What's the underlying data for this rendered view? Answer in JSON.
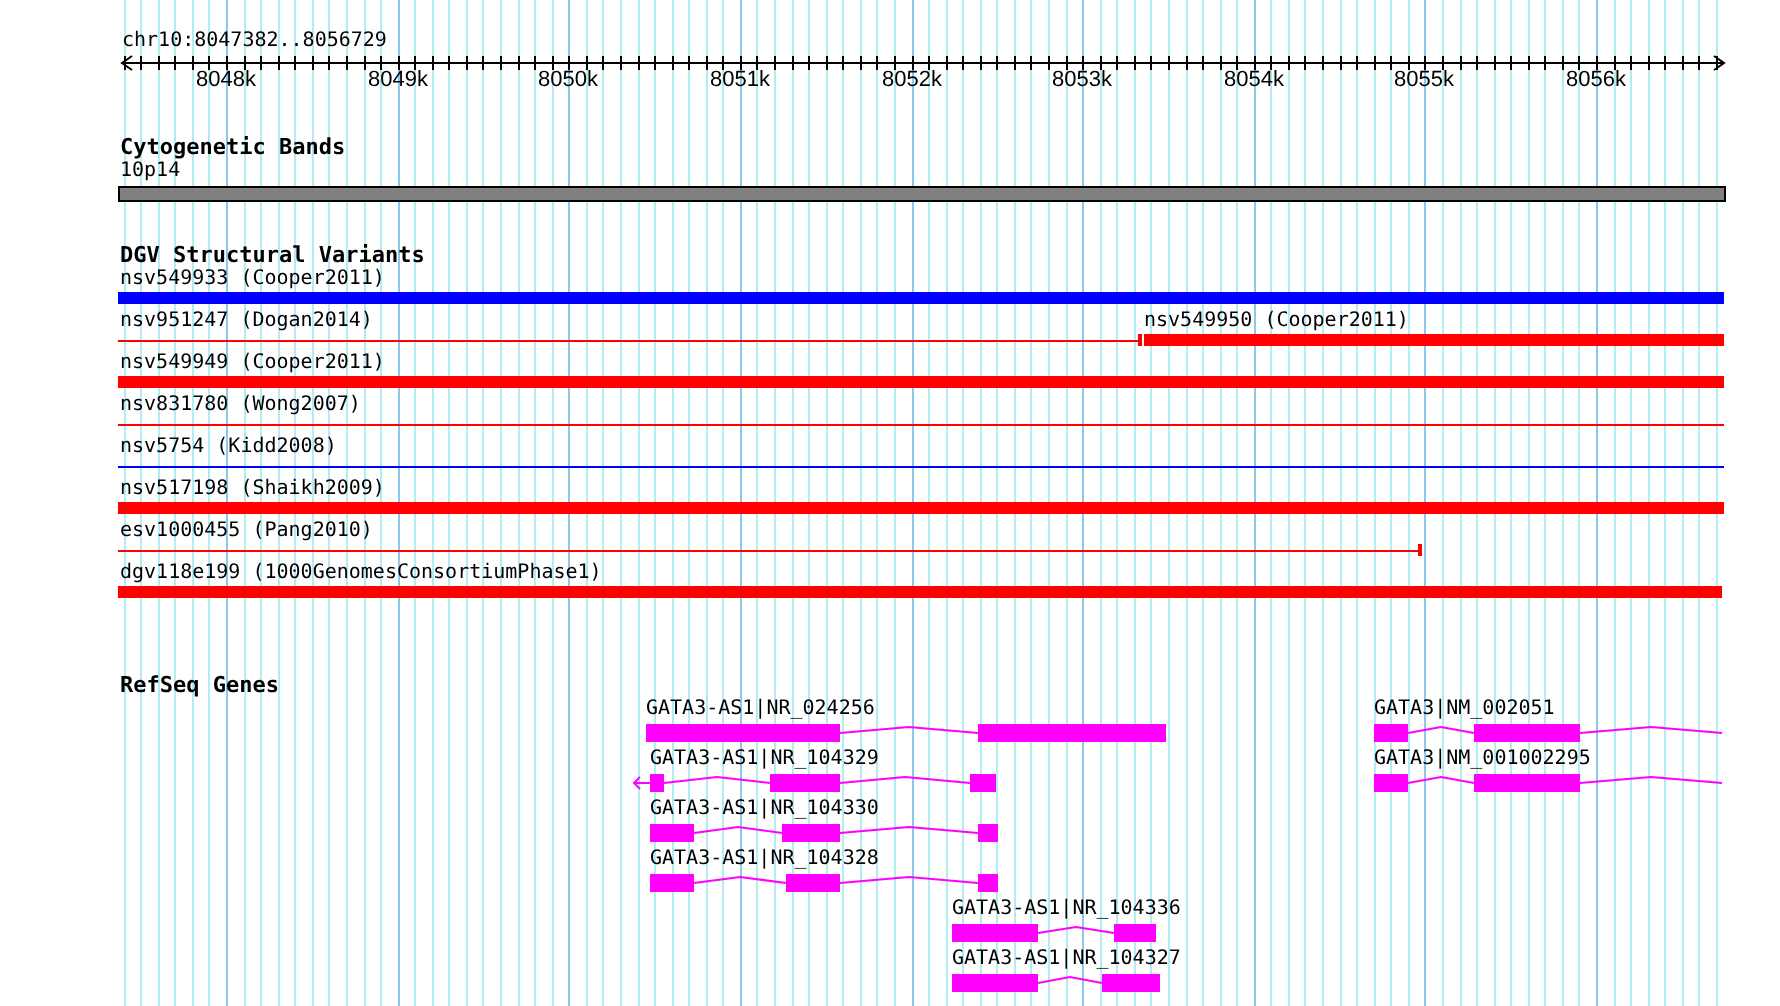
{
  "ruler": {
    "region": "chr10:8047382..8056729",
    "ticks": [
      "8048k",
      "8049k",
      "8050k",
      "8051k",
      "8052k",
      "8053k",
      "8054k",
      "8055k",
      "8056k"
    ]
  },
  "cytogenetic_bands": {
    "title": "Cytogenetic Bands",
    "band": "10p14"
  },
  "structural_variants": {
    "title": "DGV Structural Variants",
    "rows": [
      {
        "features": [
          {
            "label": "nsv549933 (Cooper2011)",
            "color": "#0000ff",
            "kind": "box"
          }
        ]
      },
      {
        "features": [
          {
            "label": "nsv951247 (Dogan2014)",
            "color": "#ff0000",
            "kind": "line"
          },
          {
            "label": "nsv549950 (Cooper2011)",
            "color": "#ff0000",
            "kind": "box"
          }
        ]
      },
      {
        "features": [
          {
            "label": "nsv549949 (Cooper2011)",
            "color": "#ff0000",
            "kind": "box"
          }
        ]
      },
      {
        "features": [
          {
            "label": "nsv831780 (Wong2007)",
            "color": "#ff0000",
            "kind": "line"
          }
        ]
      },
      {
        "features": [
          {
            "label": "nsv5754 (Kidd2008)",
            "color": "#0000ff",
            "kind": "line"
          }
        ]
      },
      {
        "features": [
          {
            "label": "nsv517198 (Shaikh2009)",
            "color": "#ff0000",
            "kind": "box"
          }
        ]
      },
      {
        "features": [
          {
            "label": "esv1000455 (Pang2010)",
            "color": "#ff0000",
            "kind": "line"
          }
        ]
      },
      {
        "features": [
          {
            "label": "dgv118e199 (1000GenomesConsortiumPhase1)",
            "color": "#ff0000",
            "kind": "box"
          }
        ]
      }
    ]
  },
  "refseq_genes": {
    "title": "RefSeq Genes",
    "genes": [
      {
        "label": "GATA3-AS1|NR_024256",
        "strand_arrow": false
      },
      {
        "label": "GATA3-AS1|NR_104329",
        "strand_arrow": true
      },
      {
        "label": "GATA3-AS1|NR_104330",
        "strand_arrow": false
      },
      {
        "label": "GATA3-AS1|NR_104328",
        "strand_arrow": false
      },
      {
        "label": "GATA3-AS1|NR_104336",
        "strand_arrow": false
      },
      {
        "label": "GATA3-AS1|NR_104327",
        "strand_arrow": false
      },
      {
        "label": "GATA3|NM_002051",
        "strand_arrow": false
      },
      {
        "label": "GATA3|NM_001002295",
        "strand_arrow": false
      }
    ]
  }
}
